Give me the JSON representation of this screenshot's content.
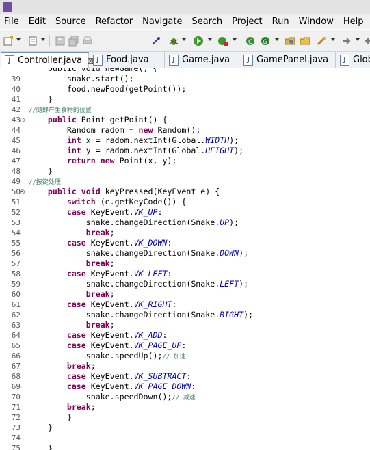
{
  "window": {
    "icon": "eclipse-icon"
  },
  "menubar": {
    "items": [
      "File",
      "Edit",
      "Source",
      "Refactor",
      "Navigate",
      "Search",
      "Project",
      "Run",
      "Window",
      "Help"
    ]
  },
  "toolbar": {
    "icons": [
      "new-wizard-icon",
      "new-file-icon",
      "save-icon",
      "save-all-icon",
      "print-icon",
      "pin-icon",
      "debug-icon",
      "run-icon",
      "external-tools-icon",
      "new-java-class-icon",
      "open-type-icon",
      "open-folder-icon",
      "search-icon",
      "next-annotation-icon"
    ]
  },
  "tabs": [
    {
      "label": "Controller.java",
      "active": true,
      "close": "⊠"
    },
    {
      "label": "Food.java",
      "active": false
    },
    {
      "label": "Game.java",
      "active": false
    },
    {
      "label": "GamePanel.java",
      "active": false
    },
    {
      "label": "Glob",
      "active": false
    }
  ],
  "editor": {
    "lines": [
      {
        "n": "",
        "fold": false,
        "segs": [
          {
            "t": "    public void newGame() {"
          }
        ]
      },
      {
        "n": "39",
        "fold": false,
        "segs": [
          {
            "t": "        snake.start();"
          }
        ]
      },
      {
        "n": "40",
        "fold": false,
        "segs": [
          {
            "t": "        food.newFood(getPoint());"
          }
        ]
      },
      {
        "n": "41",
        "fold": false,
        "segs": [
          {
            "t": "    }"
          }
        ]
      },
      {
        "n": "42",
        "fold": false,
        "segs": [
          {
            "t": "//随即产生食物的位置",
            "c": "cm"
          }
        ]
      },
      {
        "n": "43",
        "fold": true,
        "segs": [
          {
            "t": "    "
          },
          {
            "t": "public",
            "c": "kw"
          },
          {
            "t": " Point getPoint() {"
          }
        ]
      },
      {
        "n": "44",
        "fold": false,
        "segs": [
          {
            "t": "        Random radom = "
          },
          {
            "t": "new",
            "c": "kw"
          },
          {
            "t": " Random();"
          }
        ]
      },
      {
        "n": "45",
        "fold": false,
        "segs": [
          {
            "t": "        "
          },
          {
            "t": "int",
            "c": "kw"
          },
          {
            "t": " x = radom.nextInt(Global."
          },
          {
            "t": "WIDTH",
            "c": "cst"
          },
          {
            "t": ");"
          }
        ]
      },
      {
        "n": "46",
        "fold": false,
        "segs": [
          {
            "t": "        "
          },
          {
            "t": "int",
            "c": "kw"
          },
          {
            "t": " y = radom.nextInt(Global."
          },
          {
            "t": "HEIGHT",
            "c": "cst"
          },
          {
            "t": ");"
          }
        ]
      },
      {
        "n": "47",
        "fold": false,
        "segs": [
          {
            "t": "        "
          },
          {
            "t": "return",
            "c": "kw"
          },
          {
            "t": " "
          },
          {
            "t": "new",
            "c": "kw"
          },
          {
            "t": " Point(x, y);"
          }
        ]
      },
      {
        "n": "48",
        "fold": false,
        "segs": [
          {
            "t": "    }"
          }
        ]
      },
      {
        "n": "49",
        "fold": false,
        "segs": [
          {
            "t": "//按键处理",
            "c": "cm"
          }
        ]
      },
      {
        "n": "50",
        "fold": true,
        "segs": [
          {
            "t": "    "
          },
          {
            "t": "public",
            "c": "kw"
          },
          {
            "t": " "
          },
          {
            "t": "void",
            "c": "kw"
          },
          {
            "t": " keyPressed(KeyEvent e) {"
          }
        ]
      },
      {
        "n": "51",
        "fold": false,
        "segs": [
          {
            "t": "        "
          },
          {
            "t": "switch",
            "c": "kw"
          },
          {
            "t": " (e.getKeyCode()) {"
          }
        ]
      },
      {
        "n": "52",
        "fold": false,
        "segs": [
          {
            "t": "        "
          },
          {
            "t": "case",
            "c": "kw"
          },
          {
            "t": " KeyEvent."
          },
          {
            "t": "VK_UP",
            "c": "cst"
          },
          {
            "t": ":"
          }
        ]
      },
      {
        "n": "53",
        "fold": false,
        "segs": [
          {
            "t": "            snake.changeDirection(Snake."
          },
          {
            "t": "UP",
            "c": "cst"
          },
          {
            "t": ");"
          }
        ]
      },
      {
        "n": "54",
        "fold": false,
        "segs": [
          {
            "t": "            "
          },
          {
            "t": "break",
            "c": "kw"
          },
          {
            "t": ";"
          }
        ]
      },
      {
        "n": "55",
        "fold": false,
        "segs": [
          {
            "t": "        "
          },
          {
            "t": "case",
            "c": "kw"
          },
          {
            "t": " KeyEvent."
          },
          {
            "t": "VK_DOWN",
            "c": "cst"
          },
          {
            "t": ":"
          }
        ]
      },
      {
        "n": "56",
        "fold": false,
        "segs": [
          {
            "t": "            snake.changeDirection(Snake."
          },
          {
            "t": "DOWN",
            "c": "cst"
          },
          {
            "t": ");"
          }
        ]
      },
      {
        "n": "57",
        "fold": false,
        "segs": [
          {
            "t": "            "
          },
          {
            "t": "break",
            "c": "kw"
          },
          {
            "t": ";"
          }
        ]
      },
      {
        "n": "58",
        "fold": false,
        "segs": [
          {
            "t": "        "
          },
          {
            "t": "case",
            "c": "kw"
          },
          {
            "t": " KeyEvent."
          },
          {
            "t": "VK_LEFT",
            "c": "cst"
          },
          {
            "t": ":"
          }
        ]
      },
      {
        "n": "59",
        "fold": false,
        "segs": [
          {
            "t": "            snake.changeDirection(Snake."
          },
          {
            "t": "LEFT",
            "c": "cst"
          },
          {
            "t": ");"
          }
        ]
      },
      {
        "n": "60",
        "fold": false,
        "segs": [
          {
            "t": "            "
          },
          {
            "t": "break",
            "c": "kw"
          },
          {
            "t": ";"
          }
        ]
      },
      {
        "n": "61",
        "fold": false,
        "segs": [
          {
            "t": "        "
          },
          {
            "t": "case",
            "c": "kw"
          },
          {
            "t": " KeyEvent."
          },
          {
            "t": "VK_RIGHT",
            "c": "cst"
          },
          {
            "t": ":"
          }
        ]
      },
      {
        "n": "62",
        "fold": false,
        "segs": [
          {
            "t": "            snake.changeDirection(Snake."
          },
          {
            "t": "RIGHT",
            "c": "cst"
          },
          {
            "t": ");"
          }
        ]
      },
      {
        "n": "63",
        "fold": false,
        "segs": [
          {
            "t": "            "
          },
          {
            "t": "break",
            "c": "kw"
          },
          {
            "t": ";"
          }
        ]
      },
      {
        "n": "64",
        "fold": false,
        "segs": [
          {
            "t": "        "
          },
          {
            "t": "case",
            "c": "kw"
          },
          {
            "t": " KeyEvent."
          },
          {
            "t": "VK_ADD",
            "c": "cst"
          },
          {
            "t": ":"
          }
        ]
      },
      {
        "n": "65",
        "fold": false,
        "segs": [
          {
            "t": "        "
          },
          {
            "t": "case",
            "c": "kw"
          },
          {
            "t": " KeyEvent."
          },
          {
            "t": "VK_PAGE_UP",
            "c": "cst"
          },
          {
            "t": ":"
          }
        ]
      },
      {
        "n": "66",
        "fold": false,
        "segs": [
          {
            "t": "            snake.speedUp();"
          },
          {
            "t": "// 加速",
            "c": "cm"
          }
        ]
      },
      {
        "n": "67",
        "fold": false,
        "segs": [
          {
            "t": "        "
          },
          {
            "t": "break",
            "c": "kw"
          },
          {
            "t": ";"
          }
        ]
      },
      {
        "n": "68",
        "fold": false,
        "segs": [
          {
            "t": "        "
          },
          {
            "t": "case",
            "c": "kw"
          },
          {
            "t": " KeyEvent."
          },
          {
            "t": "VK_SUBTRACT",
            "c": "cst"
          },
          {
            "t": ":"
          }
        ]
      },
      {
        "n": "69",
        "fold": false,
        "segs": [
          {
            "t": "        "
          },
          {
            "t": "case",
            "c": "kw"
          },
          {
            "t": " KeyEvent."
          },
          {
            "t": "VK_PAGE_DOWN",
            "c": "cst"
          },
          {
            "t": ":"
          }
        ]
      },
      {
        "n": "70",
        "fold": false,
        "segs": [
          {
            "t": "            snake.speedDown();"
          },
          {
            "t": "// 减速",
            "c": "cm"
          }
        ]
      },
      {
        "n": "71",
        "fold": false,
        "segs": [
          {
            "t": "        "
          },
          {
            "t": "break",
            "c": "kw"
          },
          {
            "t": ";"
          }
        ]
      },
      {
        "n": "72",
        "fold": false,
        "segs": [
          {
            "t": "        }"
          }
        ]
      },
      {
        "n": "73",
        "fold": false,
        "segs": [
          {
            "t": "    }"
          }
        ]
      },
      {
        "n": "74",
        "fold": false,
        "segs": [
          {
            "t": ""
          }
        ]
      },
      {
        "n": "75",
        "fold": false,
        "segs": [
          {
            "t": "    }"
          }
        ]
      }
    ]
  }
}
